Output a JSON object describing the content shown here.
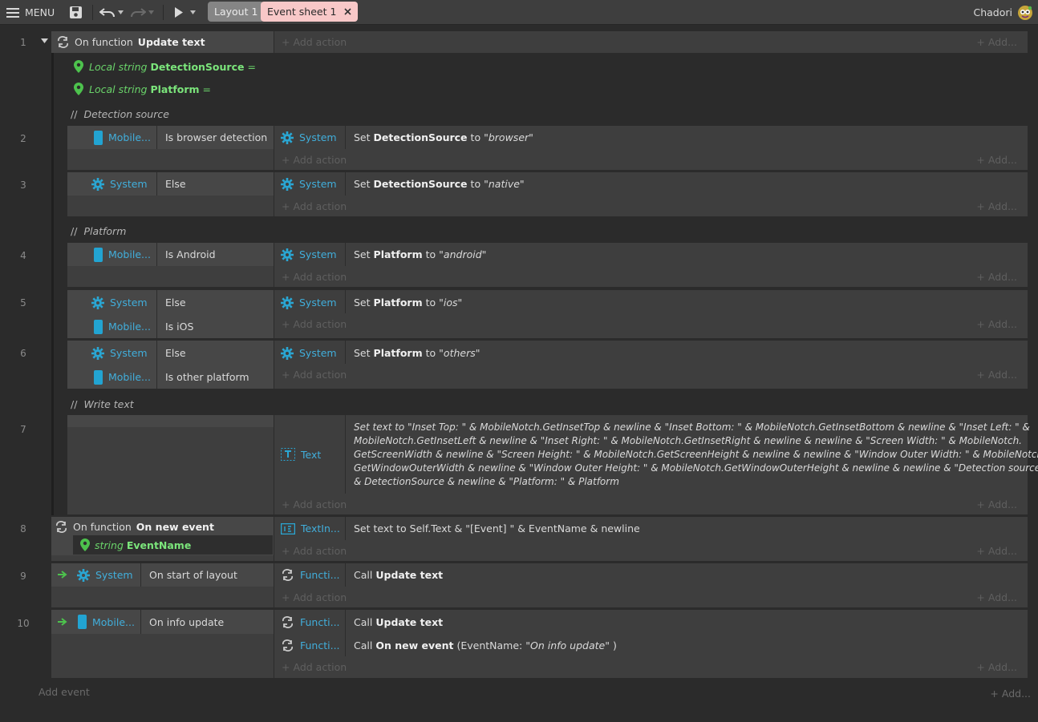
{
  "toolbar": {
    "menu": "MENU",
    "tab_layout": "Layout 1",
    "tab_events": "Event sheet 1",
    "user": "Chadori"
  },
  "common": {
    "add_action": "Add action",
    "add_more": "Add...",
    "system": "System",
    "mobile": "Mobile...",
    "else": "Else",
    "func": "Functi..."
  },
  "e1": {
    "num": "1",
    "prefix": "On function",
    "name": "Update text",
    "var1_type": "Local string",
    "var1_name": "DetectionSource",
    "eq": "=",
    "var2_type": "Local string",
    "var2_name": "Platform"
  },
  "c1": {
    "slashes": "//",
    "text": "Detection source"
  },
  "e2": {
    "num": "2",
    "cond": "Is browser detection",
    "set": "Set",
    "var": "DetectionSource",
    "to": "to",
    "val": "\"browser\""
  },
  "e3": {
    "num": "3",
    "set": "Set",
    "var": "DetectionSource",
    "to": "to",
    "val": "\"native\""
  },
  "c2": {
    "slashes": "//",
    "text": "Platform"
  },
  "e4": {
    "num": "4",
    "cond": "Is Android",
    "set": "Set",
    "var": "Platform",
    "to": "to",
    "val": "\"android\""
  },
  "e5": {
    "num": "5",
    "cond2": "Is iOS",
    "set": "Set",
    "var": "Platform",
    "to": "to",
    "val": "\"ios\""
  },
  "e6": {
    "num": "6",
    "cond2": "Is other platform",
    "set": "Set",
    "var": "Platform",
    "to": "to",
    "val": "\"others\""
  },
  "c3": {
    "slashes": "//",
    "text": "Write text"
  },
  "e7": {
    "num": "7",
    "obj": "Text",
    "line1": "Set text to \"Inset Top: \" & MobileNotch.GetInsetTop & newline & \"Inset Bottom: \" & MobileNotch.GetInsetBottom & newline & \"Inset Left: \" &",
    "line2": "MobileNotch.GetInsetLeft & newline & \"Inset Right: \" & MobileNotch.GetInsetRight & newline & newline & \"Screen Width: \" & MobileNotch.",
    "line3": "GetScreenWidth & newline & \"Screen Height: \" & MobileNotch.GetScreenHeight & newline & newline & \"Window Outer Width: \" & MobileNotch.",
    "line4": "GetWindowOuterWidth & newline & \"Window Outer Height: \" & MobileNotch.GetWindowOuterHeight & newline & newline & \"Detection source: \"",
    "line5": "& DetectionSource & newline & \"Platform: \" & Platform"
  },
  "e8": {
    "num": "8",
    "prefix": "On function",
    "name": "On new event",
    "param_type": "string",
    "param_name": "EventName",
    "obj": "TextIn...",
    "action": "Set text to Self.Text & \"[Event] \" & EventName & newline"
  },
  "e9": {
    "num": "9",
    "cond": "On start of layout",
    "call": "Call",
    "fn": "Update text"
  },
  "e10": {
    "num": "10",
    "cond": "On info update",
    "call": "Call",
    "fn1": "Update text",
    "fn2": "On new event",
    "param_open": "(EventName:",
    "param_val": "\"On info update\"",
    "param_close": ")"
  },
  "footer": {
    "add_event": "Add event",
    "add_more": "Add..."
  }
}
